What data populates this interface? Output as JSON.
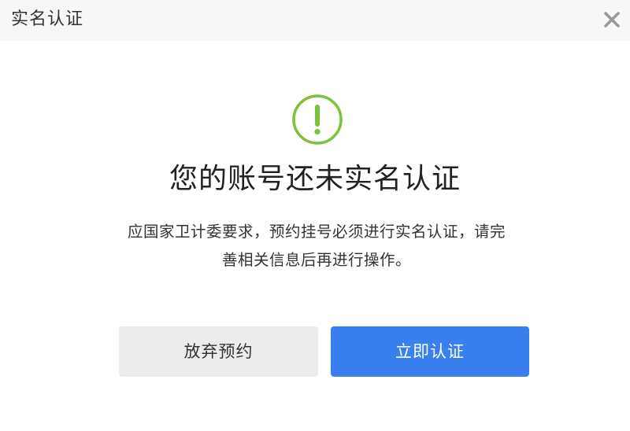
{
  "dialog": {
    "title": "实名认证",
    "close_icon": "close-icon"
  },
  "alert": {
    "icon": "exclamation-circle-icon",
    "icon_color": "#7cc13a",
    "heading": "您的账号还未实名认证",
    "body": "应国家卫计委要求，预约挂号必须进行实名认证，请完\n善相关信息后再进行操作。"
  },
  "buttons": {
    "cancel_label": "放弃预约",
    "confirm_label": "立即认证"
  },
  "colors": {
    "primary": "#3a7ff0",
    "secondary_button_bg": "#ececec",
    "header_bg": "#f7f7f7"
  }
}
